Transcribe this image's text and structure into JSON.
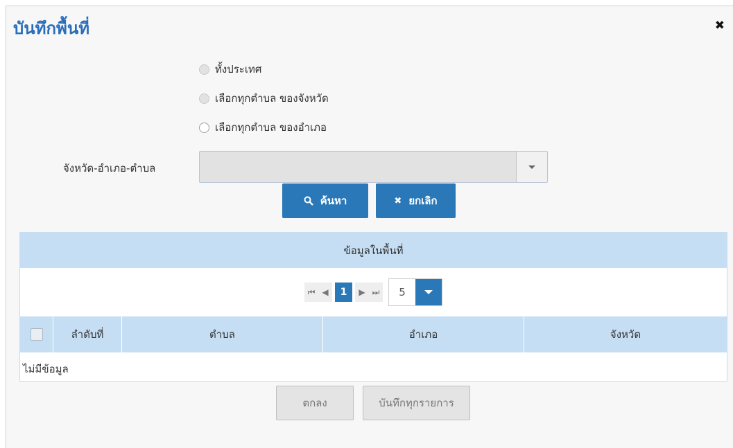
{
  "dialog": {
    "title": "บันทึกพื้นที่",
    "close_icon": "close-icon"
  },
  "scope_options": [
    {
      "label": "ทั้งประเทศ",
      "selected": false,
      "disabled": true
    },
    {
      "label": "เลือกทุกตำบล ของจังหวัด",
      "selected": false,
      "disabled": true
    },
    {
      "label": "เลือกทุกตำบล ของอำเภอ",
      "selected": false,
      "disabled": false
    }
  ],
  "area_field": {
    "label": "จังหวัด-อำเภอ-ตำบล",
    "value": ""
  },
  "actions": {
    "search_label": "ค้นหา",
    "search_icon": "search-icon",
    "cancel_label": "ยกเลิก",
    "cancel_icon": "close-icon"
  },
  "grid": {
    "caption": "ข้อมูลในพื้นที่",
    "pager": {
      "current_page": "1",
      "page_size": "5"
    },
    "columns": [
      "ลำดับที่",
      "ตำบล",
      "อำเภอ",
      "จังหวัด"
    ],
    "empty_text": "ไม่มีข้อมูล"
  },
  "footer": {
    "ok_label": "ตกลง",
    "save_all_label": "บันทึกทุกรายการ"
  },
  "colors": {
    "accent": "#2a78b8",
    "title": "#2a6ebb",
    "header_bg": "#c5def3"
  }
}
